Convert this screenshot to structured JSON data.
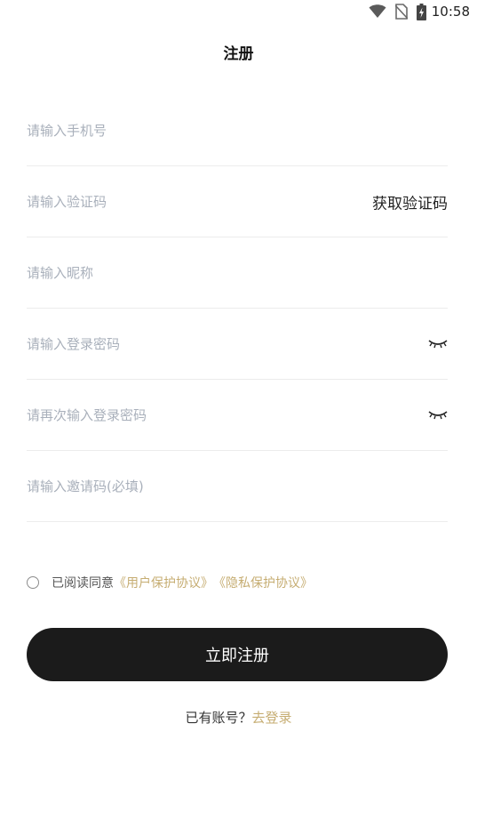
{
  "status_bar": {
    "time": "10:58",
    "icons": [
      "wifi-icon",
      "no-sim-icon",
      "battery-charging-icon"
    ]
  },
  "header": {
    "title": "注册"
  },
  "form": {
    "phone_placeholder": "请输入手机号",
    "code_placeholder": "请输入验证码",
    "get_code_label": "获取验证码",
    "nickname_placeholder": "请输入昵称",
    "password_placeholder": "请输入登录密码",
    "confirm_password_placeholder": "请再次输入登录密码",
    "invite_placeholder": "请输入邀请码(必填)",
    "eye_icon": "eye-closed-icon"
  },
  "agreement": {
    "prefix": "已阅读同意",
    "user_agreement": "《用户保护协议》",
    "privacy_agreement": "《隐私保护协议》"
  },
  "submit": {
    "label": "立即注册"
  },
  "footer": {
    "question": "已有账号？",
    "login_link": "去登录"
  },
  "colors": {
    "primary_button": "#1b1b1b",
    "link": "#c6ad72",
    "placeholder": "#a9b0bb",
    "divider": "#ececec"
  }
}
